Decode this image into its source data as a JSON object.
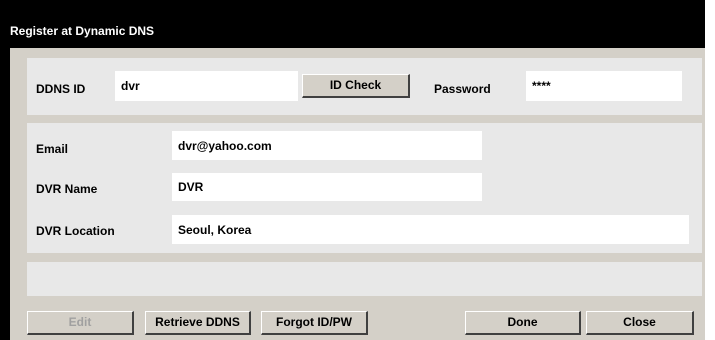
{
  "window": {
    "title": "Register at Dynamic DNS"
  },
  "ddns": {
    "id_label": "DDNS ID",
    "id_value": "dvr",
    "id_check_label": "ID Check",
    "password_label": "Password",
    "password_value": "****"
  },
  "details": {
    "email_label": "Email",
    "email_value": "dvr@yahoo.com",
    "dvr_name_label": "DVR Name",
    "dvr_name_value": "DVR",
    "dvr_location_label": "DVR Location",
    "dvr_location_value": "Seoul, Korea"
  },
  "status": {
    "message": ""
  },
  "buttons": {
    "edit": "Edit",
    "retrieve": "Retrieve DDNS",
    "forgot": "Forgot ID/PW",
    "done": "Done",
    "close": "Close"
  },
  "colors": {
    "titlebar": "#000000",
    "client": "#d4d0c8",
    "panel": "#e8e8e8",
    "field": "#ffffff"
  }
}
